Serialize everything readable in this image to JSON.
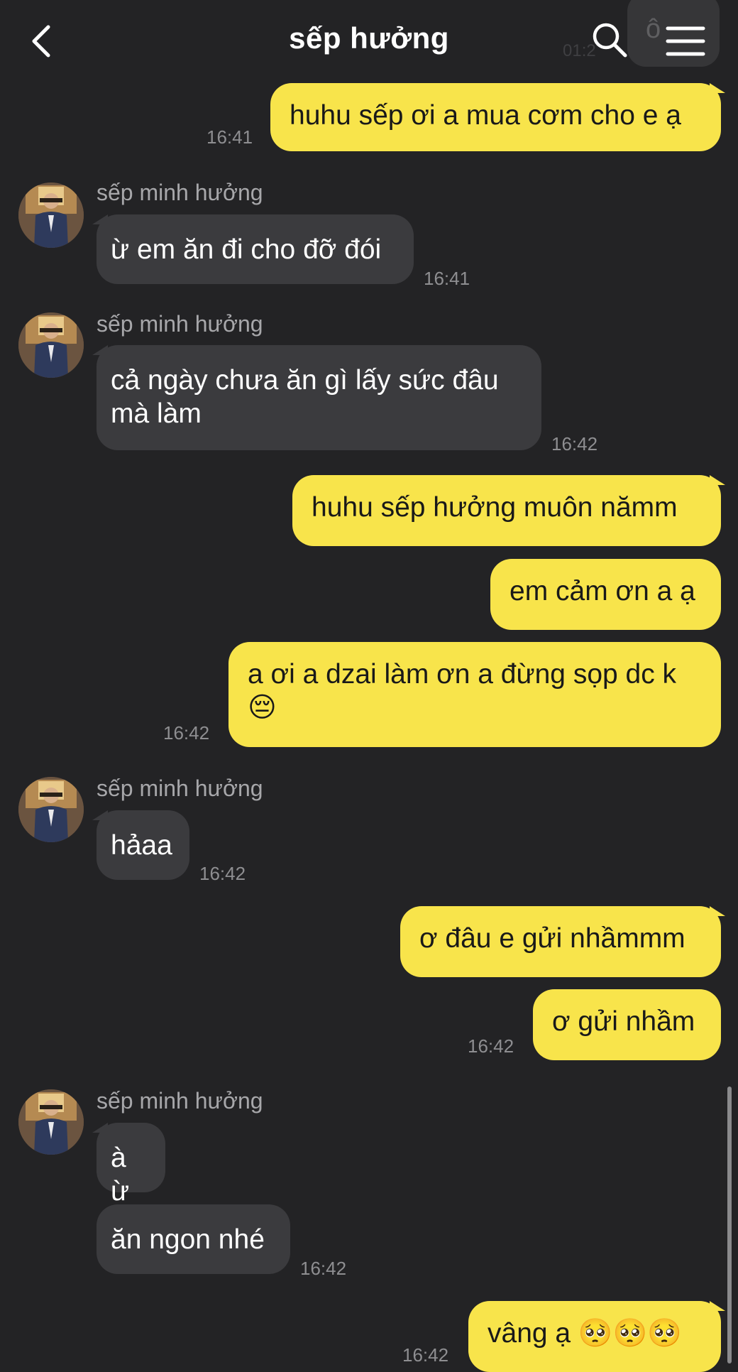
{
  "header": {
    "title": "sếp hưởng",
    "back_icon": "chevron-left-icon",
    "search_icon": "search-icon",
    "menu_icon": "hamburger-menu-icon",
    "overlay_text": "ô",
    "overlay_time": "01:2"
  },
  "contact": {
    "name": "sếp minh hưởng",
    "avatar_icon": "profile-avatar"
  },
  "colors": {
    "background": "#232325",
    "my_bubble": "#f8e44b",
    "their_bubble": "#3b3b3e",
    "my_text": "#191919",
    "their_text": "#ffffff",
    "timestamp": "#8e8e91"
  },
  "messages": [
    {
      "from": "me",
      "text": "huhu sếp ơi a mua cơm cho e ạ",
      "time": "16:41"
    },
    {
      "from": "them",
      "sender": "sếp minh hưởng",
      "text": "ừ em ăn đi cho đỡ đói",
      "time": "16:41"
    },
    {
      "from": "them",
      "sender": "sếp minh hưởng",
      "line1": "cả ngày chưa ăn gì lấy sức đâu",
      "line2": "mà làm",
      "time": "16:42"
    },
    {
      "from": "me",
      "text": "huhu sếp hưởng muôn nămm"
    },
    {
      "from": "me",
      "text": "em cảm ơn a ạ"
    },
    {
      "from": "me",
      "line1": "a ơi a dzai làm ơn a đừng sọp dc k",
      "line2": "😔",
      "time": "16:42"
    },
    {
      "from": "them",
      "sender": "sếp minh hưởng",
      "text": "hảaa",
      "time": "16:42"
    },
    {
      "from": "me",
      "text": "ơ đâu e gửi nhầmmm"
    },
    {
      "from": "me",
      "text": "ơ gửi nhầm",
      "time": "16:42"
    },
    {
      "from": "them",
      "sender": "sếp minh hưởng",
      "text": "à ừ"
    },
    {
      "from": "them",
      "text": "ăn ngon nhé",
      "time": "16:42"
    },
    {
      "from": "me",
      "text": "vâng ạ 🥺🥺🥺",
      "time": "16:42"
    }
  ]
}
